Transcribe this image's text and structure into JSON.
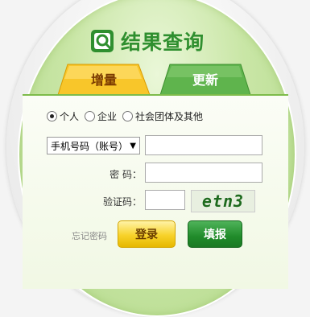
{
  "title": "结果查询",
  "tabs": {
    "zengliang": "增量",
    "gengxin": "更新"
  },
  "radios": [
    {
      "label": "个人",
      "checked": true
    },
    {
      "label": "企业",
      "checked": false
    },
    {
      "label": "社会团体及其他",
      "checked": false
    }
  ],
  "form": {
    "account_type_selected": "手机号码（账号）",
    "password_label": "密  码：",
    "captcha_label": "验证码：",
    "captcha_text": "etn3"
  },
  "links": {
    "forgot_password": "忘记密码"
  },
  "buttons": {
    "login": "登录",
    "submit": "填报"
  },
  "colors": {
    "brand_green": "#2f8f2f",
    "login_yellow": "#f7d22a",
    "submit_green": "#208b2a"
  }
}
